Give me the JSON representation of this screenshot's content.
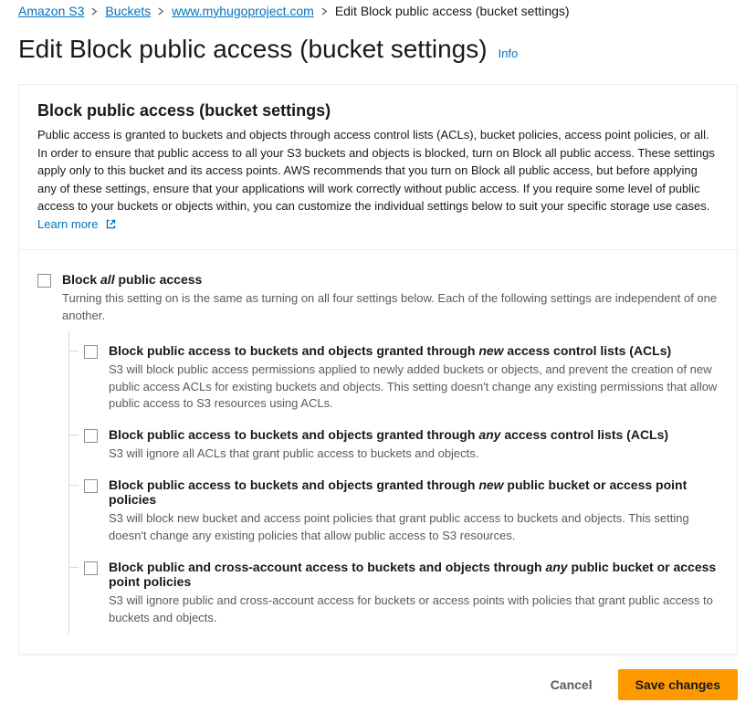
{
  "breadcrumb": {
    "items": [
      {
        "label": "Amazon S3",
        "link": true
      },
      {
        "label": "Buckets",
        "link": true
      },
      {
        "label": "www.myhugoproject.com",
        "link": true
      },
      {
        "label": "Edit Block public access (bucket settings)",
        "link": false
      }
    ]
  },
  "heading": {
    "title": "Edit Block public access (bucket settings)",
    "info": "Info"
  },
  "panel": {
    "title": "Block public access (bucket settings)",
    "description": "Public access is granted to buckets and objects through access control lists (ACLs), bucket policies, access point policies, or all. In order to ensure that public access to all your S3 buckets and objects is blocked, turn on Block all public access. These settings apply only to this bucket and its access points. AWS recommends that you turn on Block all public access, but before applying any of these settings, ensure that your applications will work correctly without public access. If you require some level of public access to your buckets or objects within, you can customize the individual settings below to suit your specific storage use cases.",
    "learn_more": "Learn more"
  },
  "options": {
    "all": {
      "title_pre": "Block ",
      "title_em": "all",
      "title_post": " public access",
      "desc": "Turning this setting on is the same as turning on all four settings below. Each of the following settings are independent of one another."
    },
    "children": [
      {
        "title_pre": "Block public access to buckets and objects granted through ",
        "title_em": "new",
        "title_post": " access control lists (ACLs)",
        "desc": "S3 will block public access permissions applied to newly added buckets or objects, and prevent the creation of new public access ACLs for existing buckets and objects. This setting doesn't change any existing permissions that allow public access to S3 resources using ACLs."
      },
      {
        "title_pre": "Block public access to buckets and objects granted through ",
        "title_em": "any",
        "title_post": " access control lists (ACLs)",
        "desc": "S3 will ignore all ACLs that grant public access to buckets and objects."
      },
      {
        "title_pre": "Block public access to buckets and objects granted through ",
        "title_em": "new",
        "title_post": " public bucket or access point policies",
        "desc": "S3 will block new bucket and access point policies that grant public access to buckets and objects. This setting doesn't change any existing policies that allow public access to S3 resources."
      },
      {
        "title_pre": "Block public and cross-account access to buckets and objects through ",
        "title_em": "any",
        "title_post": " public bucket or access point policies",
        "desc": "S3 will ignore public and cross-account access for buckets or access points with policies that grant public access to buckets and objects."
      }
    ]
  },
  "footer": {
    "cancel": "Cancel",
    "save": "Save changes"
  }
}
